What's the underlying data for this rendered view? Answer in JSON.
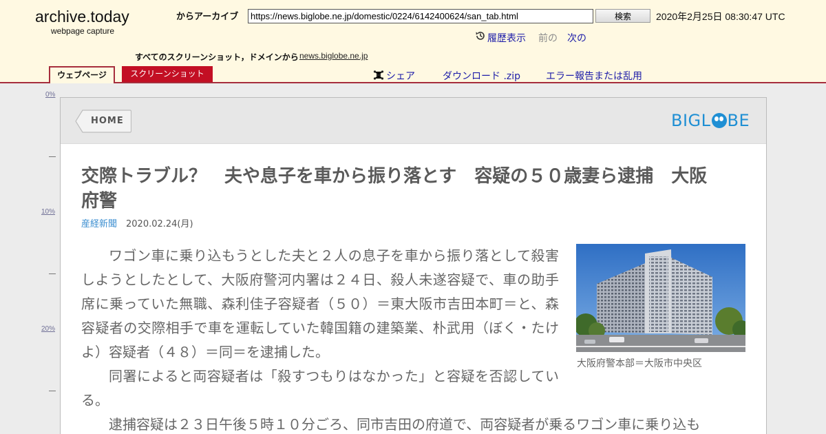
{
  "archive": {
    "logo": "archive.today",
    "logo_sub": "webpage capture",
    "from_label": "からアーカイブ",
    "url_value": "https://news.biglobe.ne.jp/domestic/0224/6142400624/san_tab.html",
    "search_button": "検索",
    "datetime": "2020年2月25日 08:30:47 UTC",
    "history_link": "履歴表示",
    "prev_label": "前の",
    "next_link": "次の",
    "all_screenshots_label": "すべてのスクリーンショット，ドメインから",
    "domain_link": "news.biglobe.ne.jp",
    "tab_webpage": "ウェブページ",
    "tab_screenshot": "スクリーンショット",
    "share_link": "シェア",
    "download_link": "ダウンロード .zip",
    "report_link": "エラー報告または乱用",
    "colors": {
      "header_bg": "#fff9e2",
      "accent": "#a62d3c",
      "tab_red": "#c30f24",
      "link": "#1c1ca8"
    }
  },
  "ruler": {
    "labels": [
      "0%",
      "10%",
      "20%"
    ]
  },
  "biglobe": {
    "home_label": "HOME",
    "logo_left": "BIGL",
    "logo_right": "BE",
    "logo_color": "#1f8fd4"
  },
  "article": {
    "title": "交際トラブル？　夫や息子を車から振り落とす　容疑の５０歳妻ら逮捕　大阪府警",
    "source": "産経新聞",
    "date": "2020.02.24(月)",
    "paragraphs": [
      "ワゴン車に乗り込もうとした夫と２人の息子を車から振り落として殺害しようとしたとして、大阪府警河内署は２４日、殺人未遂容疑で、車の助手席に乗っていた無職、森利佳子容疑者（５０）＝東大阪市吉田本町＝と、森容疑者の交際相手で車を運転していた韓国籍の建築業、朴武用（ぼく・たけよ）容疑者（４８）＝同＝を逮捕した。",
      "同署によると両容疑者は「殺すつもりはなかった」と容疑を否認している。",
      "逮捕容疑は２３日午後５時１０分ごろ、同市吉田の府道で、両容疑者が乗るワゴン車に乗り込も"
    ],
    "photo_caption": "大阪府警本部＝大阪市中央区"
  }
}
